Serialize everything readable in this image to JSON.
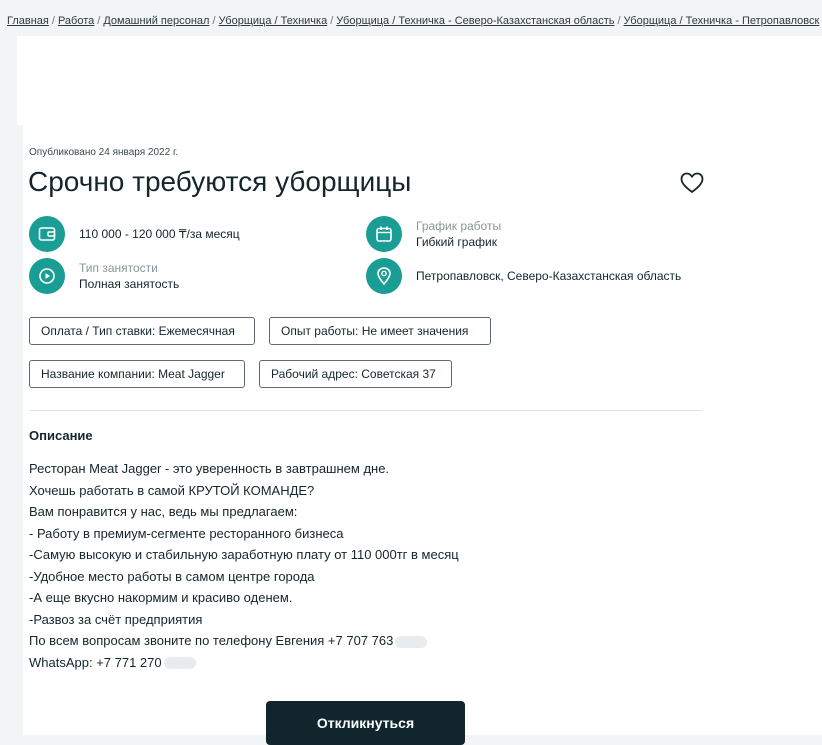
{
  "breadcrumbs": [
    "Главная",
    "Работа",
    "Домашний персонал",
    "Уборщица / Техничка",
    "Уборщица / Техничка - Северо-Казахстанская область",
    "Уборщица / Техничка - Петропавловск"
  ],
  "breadcrumb_separator": "/",
  "vacancy": {
    "published": "Опубликовано 24 января 2022 г.",
    "title": "Срочно требуются уборщицы",
    "salary": "110 000 - 120 000 ₸/за месяц",
    "schedule_label": "График работы",
    "schedule_value": "Гибкий график",
    "employment_label": "Тип занятости",
    "employment_value": "Полная занятость",
    "location": "Петропавловск, Северо-Казахстанская область"
  },
  "tags": [
    "Оплата / Тип ставки: Ежемесячная",
    "Опыт работы: Не имеет значения",
    "Название компании: Meat Jagger",
    "Рабочий адрес: Советская 37"
  ],
  "description": {
    "heading": "Описание",
    "lines": [
      "Ресторан Meat Jagger - это уверенность в завтрашнем дне.",
      "Хочешь работать в самой КРУТОЙ КОМАНДЕ?",
      "Вам понравится у нас, ведь мы предлагаем:",
      "- Работу в премиум-сегменте ресторанного бизнеса",
      "-Самую высокую и стабильную заработную плату от 110 000тг в месяц",
      "-Удобное место работы в самом центре города",
      "-А еще вкусно накормим и красиво оденем.",
      "-Развоз за счёт предприятия",
      "По всем вопросам звоните по телефону Евгения  +7 707 763",
      "WhatsApp: +7 771 270"
    ]
  },
  "apply_label": "Откликнуться",
  "icons": {
    "favorite": "heart-icon",
    "salary": "wallet-icon",
    "schedule": "calendar-icon",
    "employment": "play-circle-icon",
    "location": "map-pin-icon"
  },
  "colors": {
    "accent": "#199d94",
    "button": "#10262c",
    "text": "#14262c"
  }
}
